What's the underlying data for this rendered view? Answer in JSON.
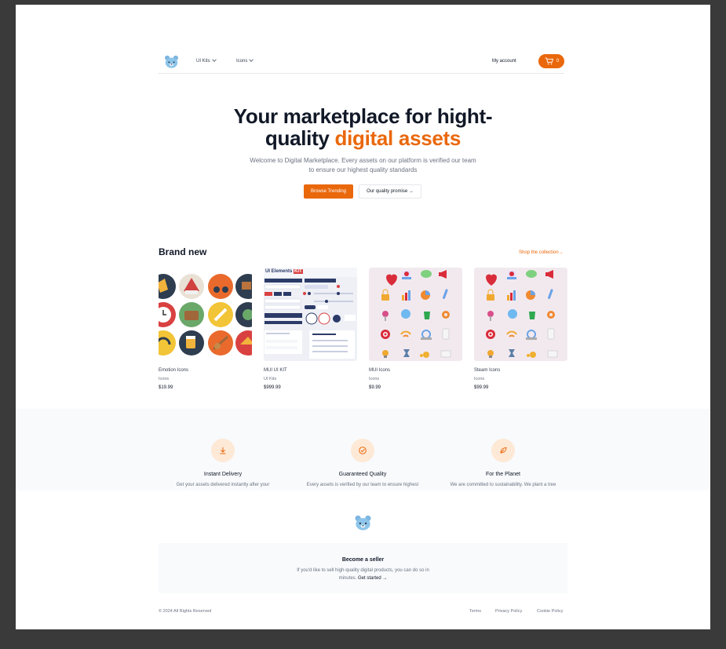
{
  "brand": {
    "logo_name": "bear-logo",
    "color": "#ea680c"
  },
  "nav": {
    "links": [
      {
        "label": "UI Kits"
      },
      {
        "label": "Icons"
      }
    ],
    "account_label": "My account",
    "cart_count": "0"
  },
  "hero": {
    "title_line1": "Your marketplace for hight-",
    "title_line2_plain": "quality ",
    "title_line2_accent": "digital assets",
    "subtitle": "Welcome to Digital Marketplace. Every assets on our platform is verified our team to ensure our highest quality standards",
    "primary_button": "Browse Trending",
    "secondary_button": "Our quality promise →"
  },
  "brand_new": {
    "title": "Brand new",
    "shop_link": "Shop the collection→",
    "products": [
      {
        "name": "Emotion Icons",
        "category": "Icons",
        "price": "$19.99"
      },
      {
        "name": "MUI UI KIT",
        "category": "UI Kits",
        "price": "$999.99",
        "thumb_title": "UI Elements",
        "thumb_badge": "KIT"
      },
      {
        "name": "MUI Icons",
        "category": "Icons",
        "price": "$9.99"
      },
      {
        "name": "Steam Icons",
        "category": "Icons",
        "price": "$99.99"
      }
    ]
  },
  "features": [
    {
      "title": "Instant Delivery",
      "icon": "download-icon",
      "description": "Get your assets delivered instantly after your"
    },
    {
      "title": "Guaranteed Quality",
      "icon": "check-circle-icon",
      "description": "Every assets is verified by our team to ensure highest"
    },
    {
      "title": "For the Planet",
      "icon": "leaf-icon",
      "description": "We are committed to sustainability. We plant a tree"
    }
  ],
  "footer": {
    "seller_title": "Become a seller",
    "seller_text": "If you'd like to sell high-quality digital products, you can do so in minutes.",
    "seller_link": "Get started →",
    "copyright": "© 2024 All Rights Reserved",
    "links": [
      {
        "label": "Terms"
      },
      {
        "label": "Privacy Policy"
      },
      {
        "label": "Cookie Policy"
      }
    ]
  }
}
